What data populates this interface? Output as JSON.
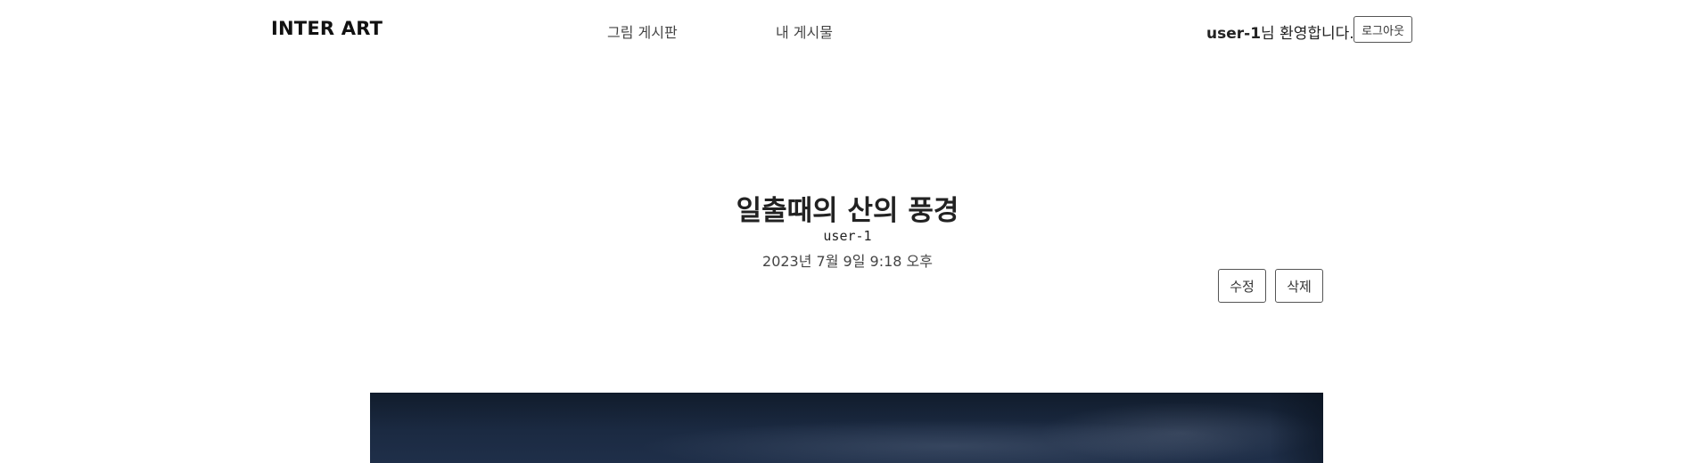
{
  "header": {
    "logo": "INTER ART",
    "nav": {
      "board": "그림 게시판",
      "my_posts": "내 게시물"
    },
    "user": {
      "name": "user-1",
      "greeting_suffix": "님 환영합니다."
    },
    "logout_label": "로그아웃"
  },
  "post": {
    "title": "일출때의 산의 풍경",
    "author": "user-1",
    "date": "2023년 7월 9일 9:18 오후",
    "edit_label": "수정",
    "delete_label": "삭제"
  },
  "colors": {
    "background": "#ffffff",
    "text": "#222222",
    "border": "#555555",
    "image_sky": "#1b2a42"
  }
}
